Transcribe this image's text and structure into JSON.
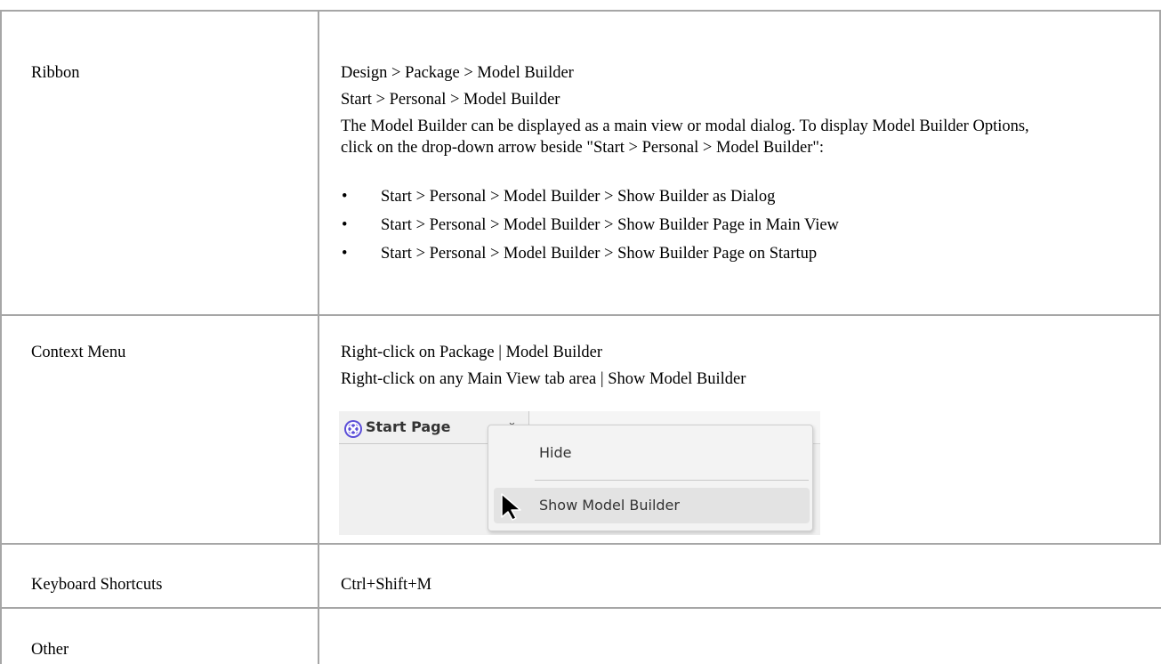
{
  "rows": {
    "ribbon": {
      "label": "Ribbon",
      "line1": "Design > Package > Model Builder",
      "line2": "Start > Personal > Model Builder",
      "para": "The Model Builder can be displayed as a main view or modal dialog.  To display Model Builder Options, click on the drop-down arrow beside \"Start > Personal > Model Builder\":",
      "bullets": [
        "Start > Personal > Model Builder > Show Builder as Dialog",
        "Start > Personal > Model Builder > Show Builder Page in Main View",
        "Start > Personal > Model Builder > Show Builder Page on Startup"
      ],
      "bullet_glyph": "•"
    },
    "context_menu": {
      "label": "Context Menu",
      "line1": "Right-click on Package | Model Builder",
      "line2": "Right-click on any Main View tab area | Show Model Builder",
      "screenshot": {
        "tab_label": "Start Page",
        "tab_chevron": "⌄",
        "menu_items": [
          "Hide",
          "Show Model Builder"
        ],
        "accent": "#5b4ed8",
        "icons": [
          "start-page-icon",
          "chevron-down-icon",
          "pointer-cursor-icon"
        ]
      }
    },
    "keyboard": {
      "label": "Keyboard Shortcuts",
      "value": "Ctrl+Shift+M"
    },
    "other": {
      "label": "Other"
    }
  },
  "colors": {
    "border": "#a6a6a6",
    "screenshot_bg": "#f0f0f0",
    "menu_highlight": "#e3e3e3"
  }
}
